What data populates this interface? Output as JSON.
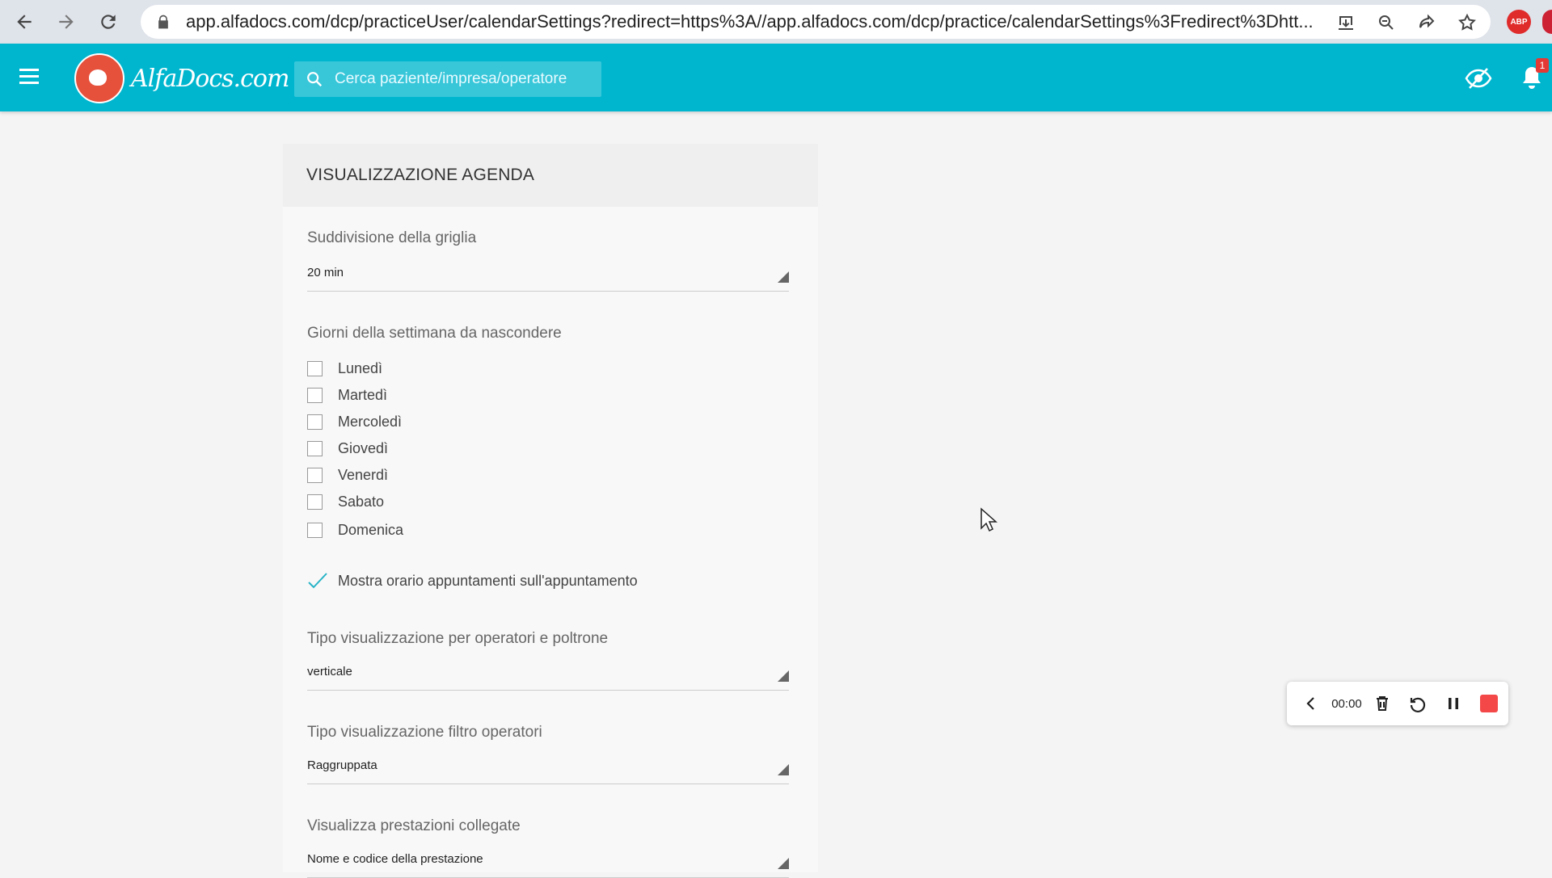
{
  "browser": {
    "url": "app.alfadocs.com/dcp/practiceUser/calendarSettings?redirect=https%3A//app.alfadocs.com/dcp/practice/calendarSettings%3Fredirect%3Dhtt...",
    "extension_label": "ABP"
  },
  "header": {
    "logo_text": "AlfaDocs.com",
    "search_placeholder": "Cerca paziente/impresa/operatore",
    "notification_count": "1",
    "colors": {
      "bar": "#00b6cf"
    }
  },
  "card": {
    "title": "VISUALIZZAZIONE AGENDA",
    "grid": {
      "label": "Suddivisione della griglia",
      "value": "20 min"
    },
    "hidden_days": {
      "label": "Giorni della settimana da nascondere",
      "days": [
        {
          "label": "Lunedì",
          "checked": false
        },
        {
          "label": "Martedì",
          "checked": false
        },
        {
          "label": "Mercoledì",
          "checked": false
        },
        {
          "label": "Giovedì",
          "checked": false
        },
        {
          "label": "Venerdì",
          "checked": false
        },
        {
          "label": "Sabato",
          "checked": false
        },
        {
          "label": "Domenica",
          "checked": false
        }
      ]
    },
    "show_time": {
      "label": "Mostra orario appuntamenti sull'appuntamento",
      "checked": true
    },
    "operators_view": {
      "label": "Tipo visualizzazione per operatori e poltrone",
      "value": "verticale"
    },
    "operators_filter": {
      "label": "Tipo visualizzazione filtro operatori",
      "value": "Raggruppata"
    },
    "linked_services": {
      "label": "Visualizza prestazioni collegate",
      "value": "Nome e codice della prestazione"
    }
  },
  "recorder": {
    "time": "00:00",
    "stop_color": "#f44848"
  }
}
